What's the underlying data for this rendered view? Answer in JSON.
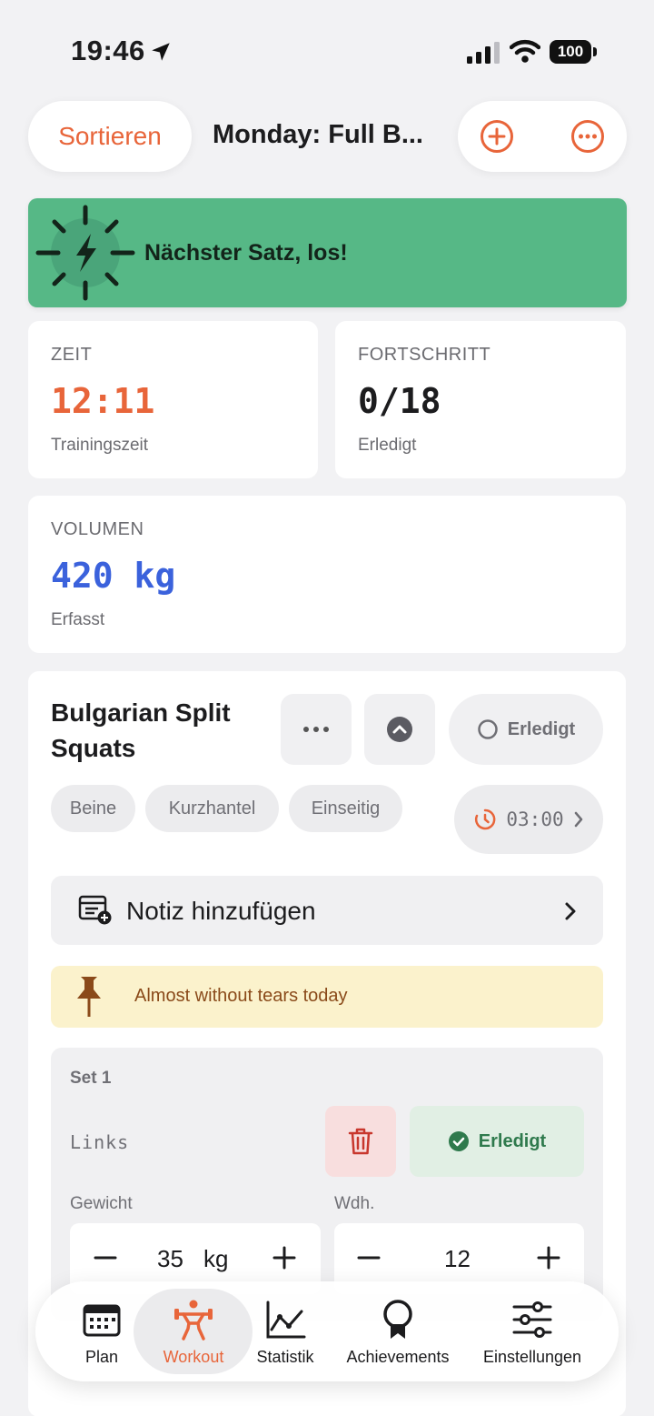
{
  "status_bar": {
    "time": "19:46",
    "battery": "100"
  },
  "nav": {
    "sort_label": "Sortieren",
    "title": "Monday: Full B..."
  },
  "banner": {
    "text": "Nächster Satz, los!"
  },
  "stats": {
    "time": {
      "label": "ZEIT",
      "value": "12:11",
      "sub": "Trainingszeit",
      "color": "#e8653a"
    },
    "progress": {
      "label": "FORTSCHRITT",
      "value": "0/18",
      "sub": "Erledigt",
      "color": "#1c1c1e"
    },
    "volume": {
      "label": "VOLUMEN",
      "value": "420 kg",
      "sub": "Erfasst",
      "color": "#3b62dc"
    }
  },
  "exercise": {
    "title": "Bulgarian Split Squats",
    "done_label": "Erledigt",
    "tags": [
      "Beine",
      "Kurzhantel",
      "Einseitig"
    ],
    "rest_timer": "03:00",
    "note_label": "Notiz hinzufügen",
    "pinned_note": "Almost without tears today",
    "set": {
      "title": "Set 1",
      "side": "Links",
      "done_label": "Erledigt",
      "weight_label": "Gewicht",
      "weight_value": "35",
      "weight_unit": "kg",
      "reps_label": "Wdh.",
      "reps_value": "12"
    }
  },
  "tabs": [
    {
      "label": "Plan",
      "icon": "calendar-icon"
    },
    {
      "label": "Workout",
      "icon": "weightlifter-icon",
      "active": true
    },
    {
      "label": "Statistik",
      "icon": "chart-icon"
    },
    {
      "label": "Achievements",
      "icon": "ribbon-icon"
    },
    {
      "label": "Einstellungen",
      "icon": "sliders-icon"
    }
  ],
  "colors": {
    "accent": "#e8653a",
    "banner": "#56b886",
    "volume": "#3b62dc",
    "done_green": "#2f7a4d"
  }
}
